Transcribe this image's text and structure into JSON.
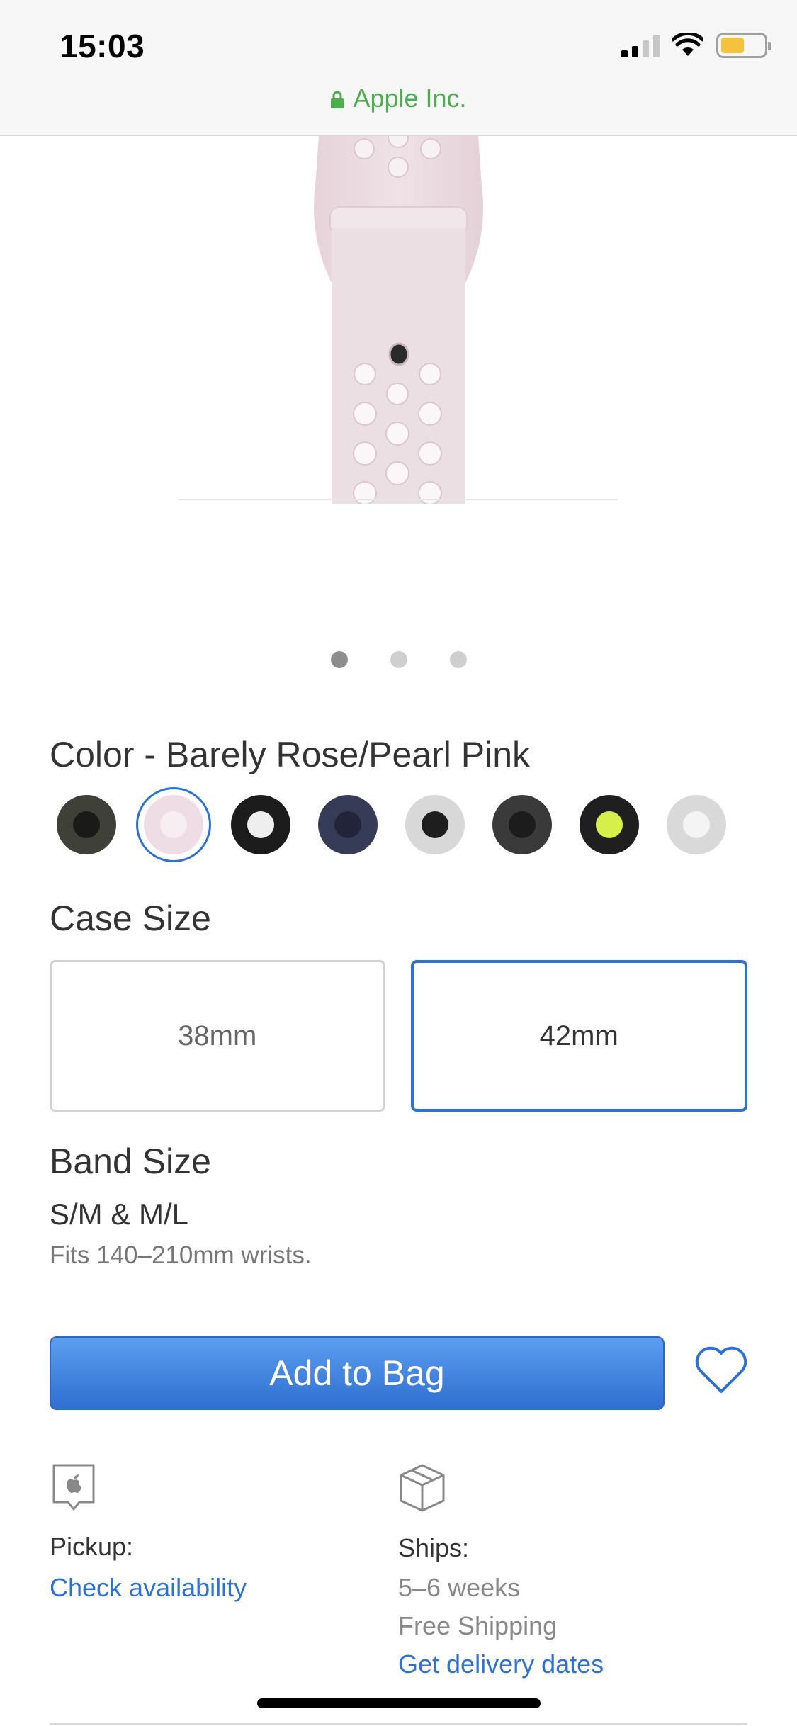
{
  "status_bar": {
    "time": "15:03"
  },
  "url_bar": {
    "site": "Apple Inc."
  },
  "carousel": {
    "page_count": 3,
    "active_index": 0
  },
  "color": {
    "label": "Color - Barely Rose/Pearl Pink",
    "swatches": [
      {
        "outer": "#3f4038",
        "inner": "#1a1a18",
        "selected": false
      },
      {
        "outer": "#eedde4",
        "inner": "#f7eef2",
        "selected": true
      },
      {
        "outer": "#1c1c1c",
        "inner": "#eeeeee",
        "selected": false
      },
      {
        "outer": "#363c58",
        "inner": "#22253a",
        "selected": false
      },
      {
        "outer": "#d8d8d8",
        "inner": "#1e1e1e",
        "selected": false
      },
      {
        "outer": "#3a3a3a",
        "inner": "#1c1c1c",
        "selected": false
      },
      {
        "outer": "#1f1f1f",
        "inner": "#d7ef4a",
        "selected": false
      },
      {
        "outer": "#d9d9d9",
        "inner": "#f4f4f4",
        "selected": false
      }
    ]
  },
  "case_size": {
    "label": "Case Size",
    "options": [
      {
        "label": "38mm",
        "selected": false
      },
      {
        "label": "42mm",
        "selected": true
      }
    ]
  },
  "band_size": {
    "label": "Band Size",
    "value": "S/M & M/L",
    "fit": "Fits 140–210mm wrists."
  },
  "actions": {
    "add_to_bag": "Add to Bag"
  },
  "pickup": {
    "label": "Pickup:",
    "link": "Check availability"
  },
  "ships": {
    "label": "Ships:",
    "eta": "5–6 weeks",
    "shipping": "Free Shipping",
    "link": "Get delivery dates"
  },
  "colors": {
    "accent": "#2c72d6",
    "secure": "#4cae4c"
  }
}
